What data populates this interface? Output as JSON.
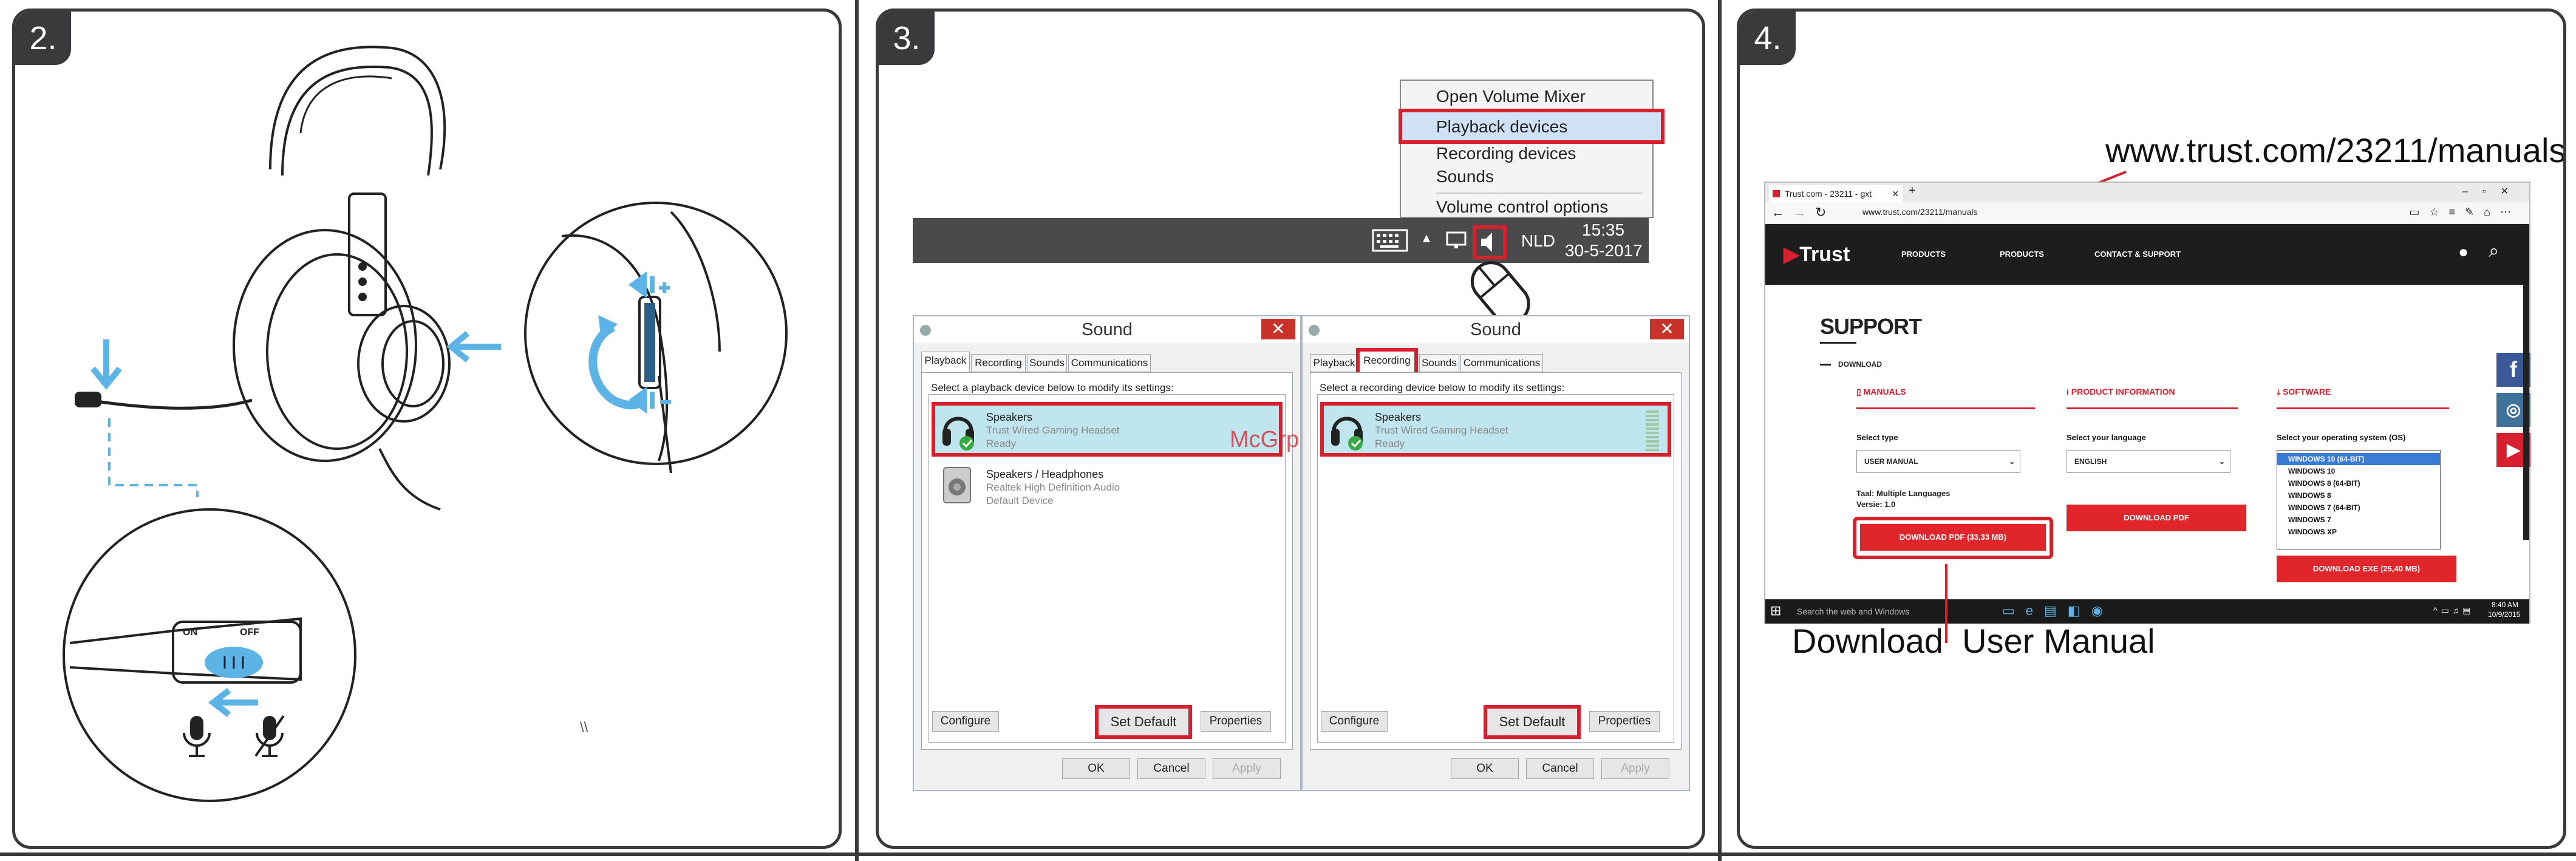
{
  "steps": {
    "s2": "2.",
    "s3": "3.",
    "s4": "4."
  },
  "headset": {
    "on": "ON",
    "off": "OFF",
    "side_mark": "\\\\"
  },
  "context_menu": {
    "items": [
      "Open Volume Mixer",
      "Playback devices",
      "Recording devices",
      "Sounds",
      "Volume control options"
    ],
    "highlight_index": 1
  },
  "taskbar": {
    "lang": "NLD",
    "time": "15:35",
    "date": "30-5-2017"
  },
  "watermark": "McGrp.Ru",
  "playback_dialog": {
    "title": "Sound",
    "tabs": [
      "Playback",
      "Recording",
      "Sounds",
      "Communications"
    ],
    "instruction": "Select a playback device below to modify its settings:",
    "devices": [
      {
        "name": "Speakers",
        "desc": "Trust Wired Gaming Headset",
        "status": "Ready"
      },
      {
        "name": "Speakers / Headphones",
        "desc": "Realtek High Definition Audio",
        "status": "Default Device"
      }
    ],
    "configure": "Configure",
    "set_default": "Set Default",
    "properties": "Properties",
    "ok": "OK",
    "cancel": "Cancel",
    "apply": "Apply"
  },
  "recording_dialog": {
    "title": "Sound",
    "tabs": [
      "Playback",
      "Recording",
      "Sounds",
      "Communications"
    ],
    "instruction": "Select a recording device below to modify its settings:",
    "devices": [
      {
        "name": "Speakers",
        "desc": "Trust Wired Gaming Headset",
        "status": "Ready"
      }
    ],
    "configure": "Configure",
    "set_default": "Set Default",
    "properties": "Properties",
    "ok": "OK",
    "cancel": "Cancel",
    "apply": "Apply"
  },
  "browser": {
    "tab_title": "Trust.com - 23211 - gxt",
    "url": "www.trust.com/23211/manuals",
    "callout_url": "www.trust.com/23211/manuals",
    "callout_download": "Download  User Manual",
    "site": {
      "logo": "Trust",
      "nav": [
        "PRODUCTS",
        "PRODUCTS",
        "CONTACT & SUPPORT"
      ],
      "support": "SUPPORT",
      "download": "DOWNLOAD",
      "manuals": "MANUALS",
      "product_info": "PRODUCT INFORMATION",
      "software": "SOFTWARE",
      "select_type": "Select type",
      "type_value": "USER MANUAL",
      "select_language": "Select your language",
      "language_value": "ENGLISH",
      "select_os": "Select your operating system (OS)",
      "os_options": [
        "WINDOWS 10 (64-BIT)",
        "WINDOWS 10",
        "WINDOWS 8 (64-BIT)",
        "WINDOWS 8",
        "WINDOWS 7 (64-BIT)",
        "WINDOWS 7",
        "WINDOWS XP"
      ],
      "lang_line": "Taal: Multiple Languages",
      "version_line": "Versie: 1.0",
      "download_pdf_size": "DOWNLOAD PDF (33,33 MB)",
      "download_pdf": "DOWNLOAD PDF",
      "download_exe": "DOWNLOAD EXE (25,40 MB)"
    },
    "taskbar_search": "Search the web and Windows",
    "clock_time": "8:40 AM",
    "clock_date": "10/9/2015"
  },
  "colors": {
    "accent_blue": "#5bb3e6",
    "brand_red": "#d7202e",
    "panel_border": "#3a3a3c"
  }
}
